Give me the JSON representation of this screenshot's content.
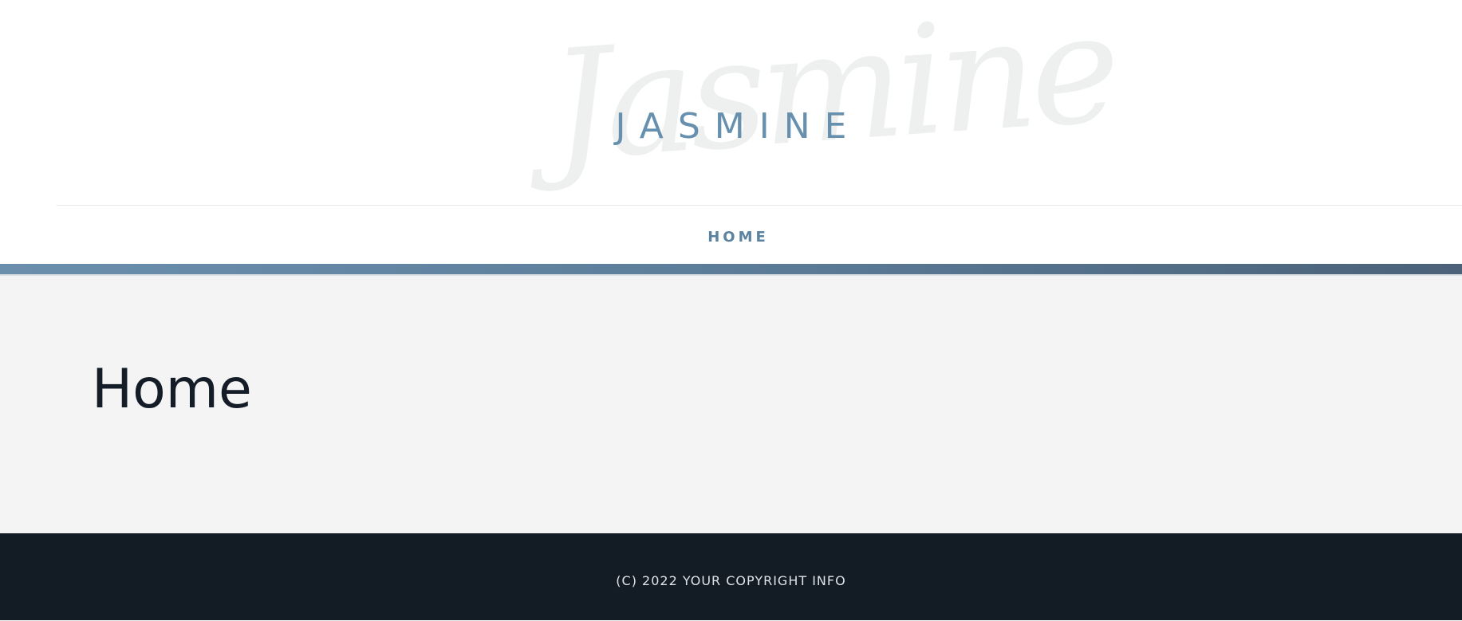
{
  "header": {
    "watermark": "Jasmine",
    "site_title": "JASMINE"
  },
  "nav": {
    "items": [
      {
        "label": "HOME"
      }
    ]
  },
  "main": {
    "page_title": "Home"
  },
  "footer": {
    "copyright": "(C) 2022 YOUR COPYRIGHT INFO"
  },
  "colors": {
    "accent": "#6690ad",
    "accent_dark": "#4b6279",
    "content_bg": "#f4f4f4",
    "footer_bg": "#131c25",
    "title_text": "#141c27"
  }
}
